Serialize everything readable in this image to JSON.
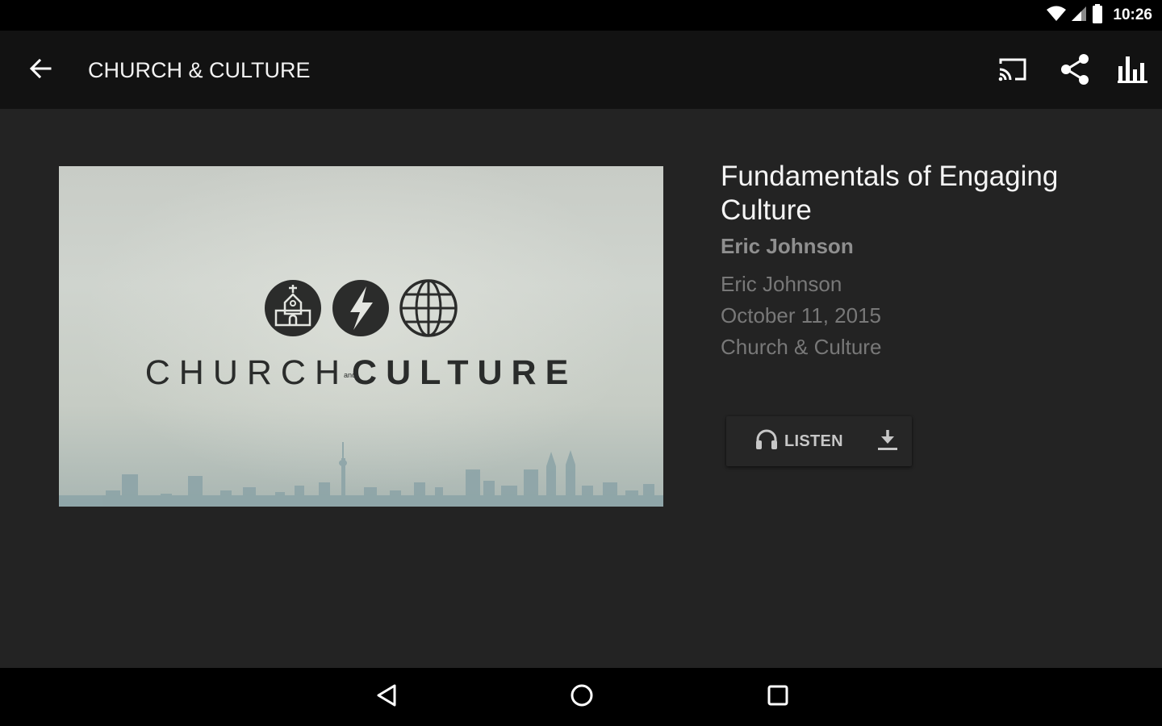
{
  "status_bar": {
    "time": "10:26",
    "icons": [
      "wifi-icon",
      "cell-signal-icon",
      "battery-icon"
    ]
  },
  "app_bar": {
    "title": "CHURCH & CULTURE",
    "actions": [
      "back-arrow-icon",
      "cast-icon",
      "share-icon",
      "bar-chart-icon"
    ]
  },
  "artwork": {
    "wordmark_left": "CHURCH",
    "wordmark_and": "and",
    "wordmark_right": "CULTURE",
    "icons": [
      "church-icon",
      "lightning-bolt-icon",
      "globe-icon"
    ]
  },
  "sermon": {
    "title": "Fundamentals of Engaging Culture",
    "speaker": "Eric Johnson",
    "meta": {
      "speaker": "Eric Johnson",
      "date": "October 11, 2015",
      "series": "Church & Culture"
    }
  },
  "actions": {
    "listen_label": "LISTEN",
    "listen_icon": "headphones-icon",
    "download_icon": "download-icon"
  },
  "nav_bar": {
    "buttons": [
      "nav-back-icon",
      "nav-home-icon",
      "nav-recents-icon"
    ]
  },
  "colors": {
    "background": "#232323",
    "app_bar": "#121212",
    "system_bars": "#000000",
    "title_text": "#f4f4f4",
    "secondary_text": "#787878"
  }
}
